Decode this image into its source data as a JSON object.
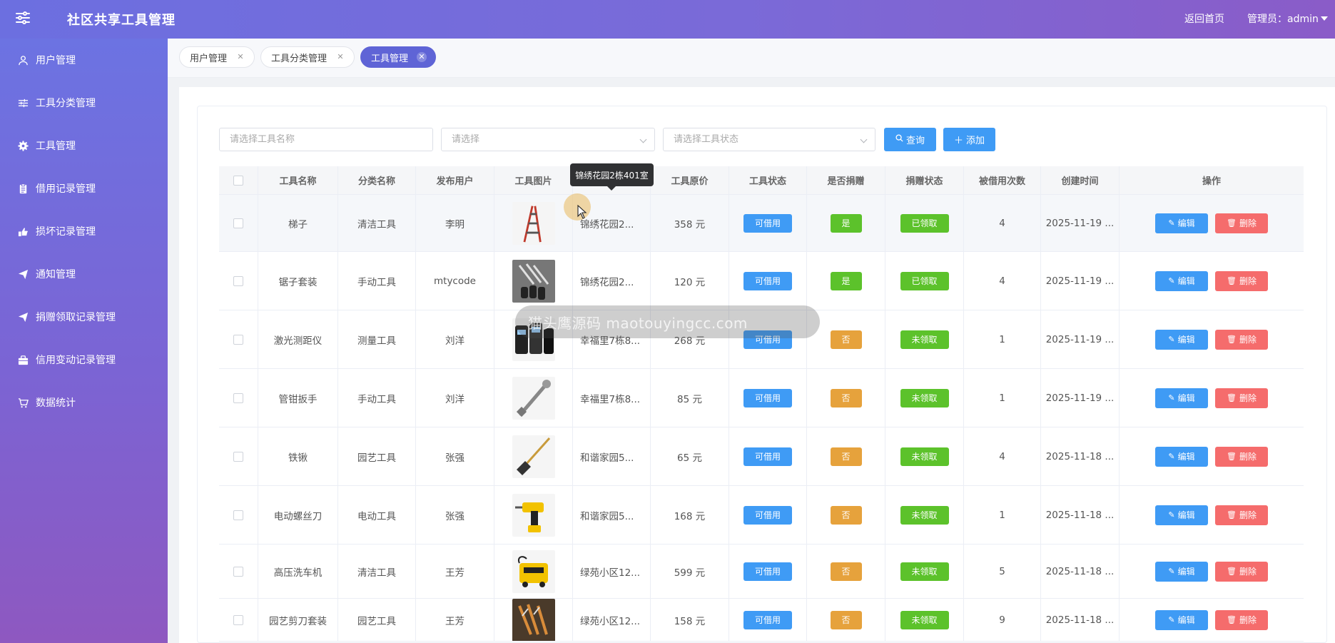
{
  "header": {
    "title": "社区共享工具管理",
    "home_link": "返回首页",
    "admin_label": "管理员：admin"
  },
  "sidebar": {
    "items": [
      {
        "label": "用户管理",
        "icon": "user-icon"
      },
      {
        "label": "工具分类管理",
        "icon": "sliders-icon"
      },
      {
        "label": "工具管理",
        "icon": "gear-icon"
      },
      {
        "label": "借用记录管理",
        "icon": "clipboard-icon"
      },
      {
        "label": "损坏记录管理",
        "icon": "broken-icon"
      },
      {
        "label": "通知管理",
        "icon": "send-icon"
      },
      {
        "label": "捐赠领取记录管理",
        "icon": "send-icon"
      },
      {
        "label": "信用变动记录管理",
        "icon": "briefcase-icon"
      },
      {
        "label": "数据统计",
        "icon": "cart-icon"
      }
    ]
  },
  "tabs": [
    {
      "label": "用户管理",
      "active": false
    },
    {
      "label": "工具分类管理",
      "active": false
    },
    {
      "label": "工具管理",
      "active": true
    }
  ],
  "search": {
    "name_placeholder": "请选择工具名称",
    "category_placeholder": "请选择",
    "status_placeholder": "请选择工具状态",
    "query_label": "查询",
    "add_label": "添加"
  },
  "table": {
    "headers": [
      "",
      "工具名称",
      "分类名称",
      "发布用户",
      "工具图片",
      "",
      "工具原价",
      "工具状态",
      "是否捐赠",
      "捐赠状态",
      "被借用次数",
      "创建时间",
      "操作"
    ],
    "edit_label": "编辑",
    "delete_label": "删除",
    "rows": [
      {
        "name": "梯子",
        "category": "清洁工具",
        "user": "李明",
        "image": "ladder",
        "address": "锦绣花园2...",
        "price": "358 元",
        "status": "可借用",
        "donated": "是",
        "donation_status": "已领取",
        "borrow_count": "4",
        "created": "2025-11-19 ..."
      },
      {
        "name": "锯子套装",
        "category": "手动工具",
        "user": "mtycode",
        "image": "saw-set",
        "address": "锦绣花园2...",
        "price": "120 元",
        "status": "可借用",
        "donated": "是",
        "donation_status": "已领取",
        "borrow_count": "4",
        "created": "2025-11-19 ..."
      },
      {
        "name": "激光测距仪",
        "category": "测量工具",
        "user": "刘洋",
        "image": "laser-meter",
        "address": "幸福里7栋8...",
        "price": "268 元",
        "status": "可借用",
        "donated": "否",
        "donation_status": "未领取",
        "borrow_count": "1",
        "created": "2025-11-19 ..."
      },
      {
        "name": "管钳扳手",
        "category": "手动工具",
        "user": "刘洋",
        "image": "wrench",
        "address": "幸福里7栋8...",
        "price": "85 元",
        "status": "可借用",
        "donated": "否",
        "donation_status": "未领取",
        "borrow_count": "1",
        "created": "2025-11-19 ..."
      },
      {
        "name": "铁锹",
        "category": "园艺工具",
        "user": "张强",
        "image": "shovel",
        "address": "和谐家园5...",
        "price": "65 元",
        "status": "可借用",
        "donated": "否",
        "donation_status": "未领取",
        "borrow_count": "4",
        "created": "2025-11-18 ..."
      },
      {
        "name": "电动螺丝刀",
        "category": "电动工具",
        "user": "张强",
        "image": "drill",
        "address": "和谐家园5...",
        "price": "168 元",
        "status": "可借用",
        "donated": "否",
        "donation_status": "未领取",
        "borrow_count": "1",
        "created": "2025-11-18 ..."
      },
      {
        "name": "高压洗车机",
        "category": "清洁工具",
        "user": "王芳",
        "image": "washer",
        "address": "绿苑小区12...",
        "price": "599 元",
        "status": "可借用",
        "donated": "否",
        "donation_status": "未领取",
        "borrow_count": "5",
        "created": "2025-11-18 ..."
      },
      {
        "name": "园艺剪刀套装",
        "category": "园艺工具",
        "user": "王芳",
        "image": "shears",
        "address": "绿苑小区12...",
        "price": "158 元",
        "status": "可借用",
        "donated": "否",
        "donation_status": "未领取",
        "borrow_count": "9",
        "created": "2025-11-18 ..."
      }
    ]
  },
  "tooltip": "锦绣花园2栋401室",
  "watermark": "猫头鹰源码 maotouyingcc.com",
  "colors": {
    "primary": "#3f9bf5",
    "success": "#5cc22b",
    "warning": "#e6a23c",
    "danger": "#f56c6c",
    "header_gradient_start": "#6c6fe0",
    "header_gradient_end": "#8a5cc8"
  }
}
